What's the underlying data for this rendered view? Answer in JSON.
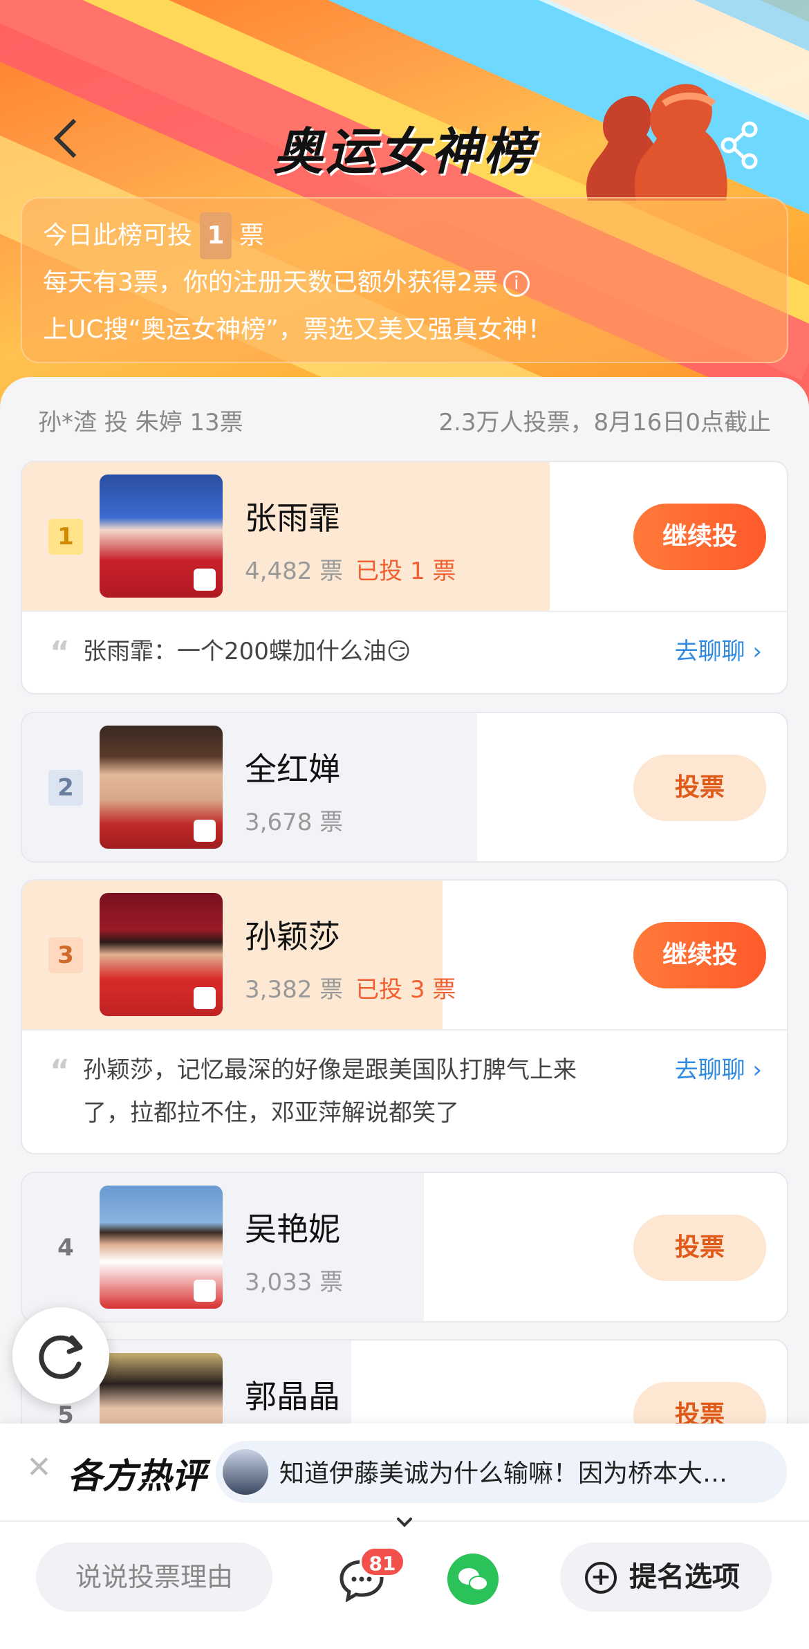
{
  "header": {
    "title": "奥运女神榜",
    "info_line1_prefix": "今日此榜可投",
    "info_line1_count": "1",
    "info_line1_suffix": "票",
    "info_line2": "每天有3票，你的注册天数已额外获得2票",
    "info_line3": "上UC搜“奥运女神榜”，票选又美又强真女神！"
  },
  "summary": {
    "latest_vote": "孙*渣 投 朱婷 13票",
    "stats": "2.3万人投票，8月16日0点截止"
  },
  "items": [
    {
      "rank": "1",
      "name": "张雨霏",
      "votes": "4,482 票",
      "my_votes": "已投 1 票",
      "button": "继续投",
      "comment": "张雨霏：一个200蝶加什么油😏",
      "chat": "去聊聊 ›",
      "progress": 0.69
    },
    {
      "rank": "2",
      "name": "全红婵",
      "votes": "3,678 票",
      "my_votes": "",
      "button": "投票",
      "progress": 0.595
    },
    {
      "rank": "3",
      "name": "孙颖莎",
      "votes": "3,382 票",
      "my_votes": "已投 3 票",
      "button": "继续投",
      "comment": "孙颖莎，记忆最深的好像是跟美国队打脾气上来了，拉都拉不住，邓亚萍解说都笑了",
      "chat": "去聊聊 ›",
      "progress": 0.55
    },
    {
      "rank": "4",
      "name": "吴艳妮",
      "votes": "3,033 票",
      "my_votes": "",
      "button": "投票",
      "progress": 0.525
    },
    {
      "rank": "5",
      "name": "郭晶晶",
      "votes": "",
      "my_votes": "",
      "button": "投票",
      "progress": 0.43
    }
  ],
  "hot": {
    "title": "各方热评",
    "text": "知道伊藤美诚为什么输嘛！因为桥本大…"
  },
  "bottom": {
    "reason_placeholder": "说说投票理由",
    "message_count": "81",
    "nominate": "提名选项"
  },
  "colors": {
    "accent": "#ff5a2a",
    "link": "#2f8ae0"
  }
}
